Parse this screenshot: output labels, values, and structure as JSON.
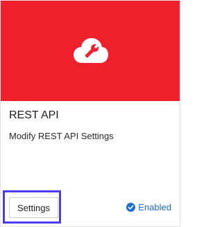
{
  "card": {
    "title": "REST API",
    "description": "Modify REST API Settings",
    "banner_color": "#f0202d",
    "banner_icon": "cloud-wrench-icon"
  },
  "actions": {
    "settings_label": "Settings",
    "status_label": "Enabled",
    "status_icon": "check-circle-icon",
    "status_color": "#1a6fcf",
    "highlight_color": "#4a3cf0"
  }
}
